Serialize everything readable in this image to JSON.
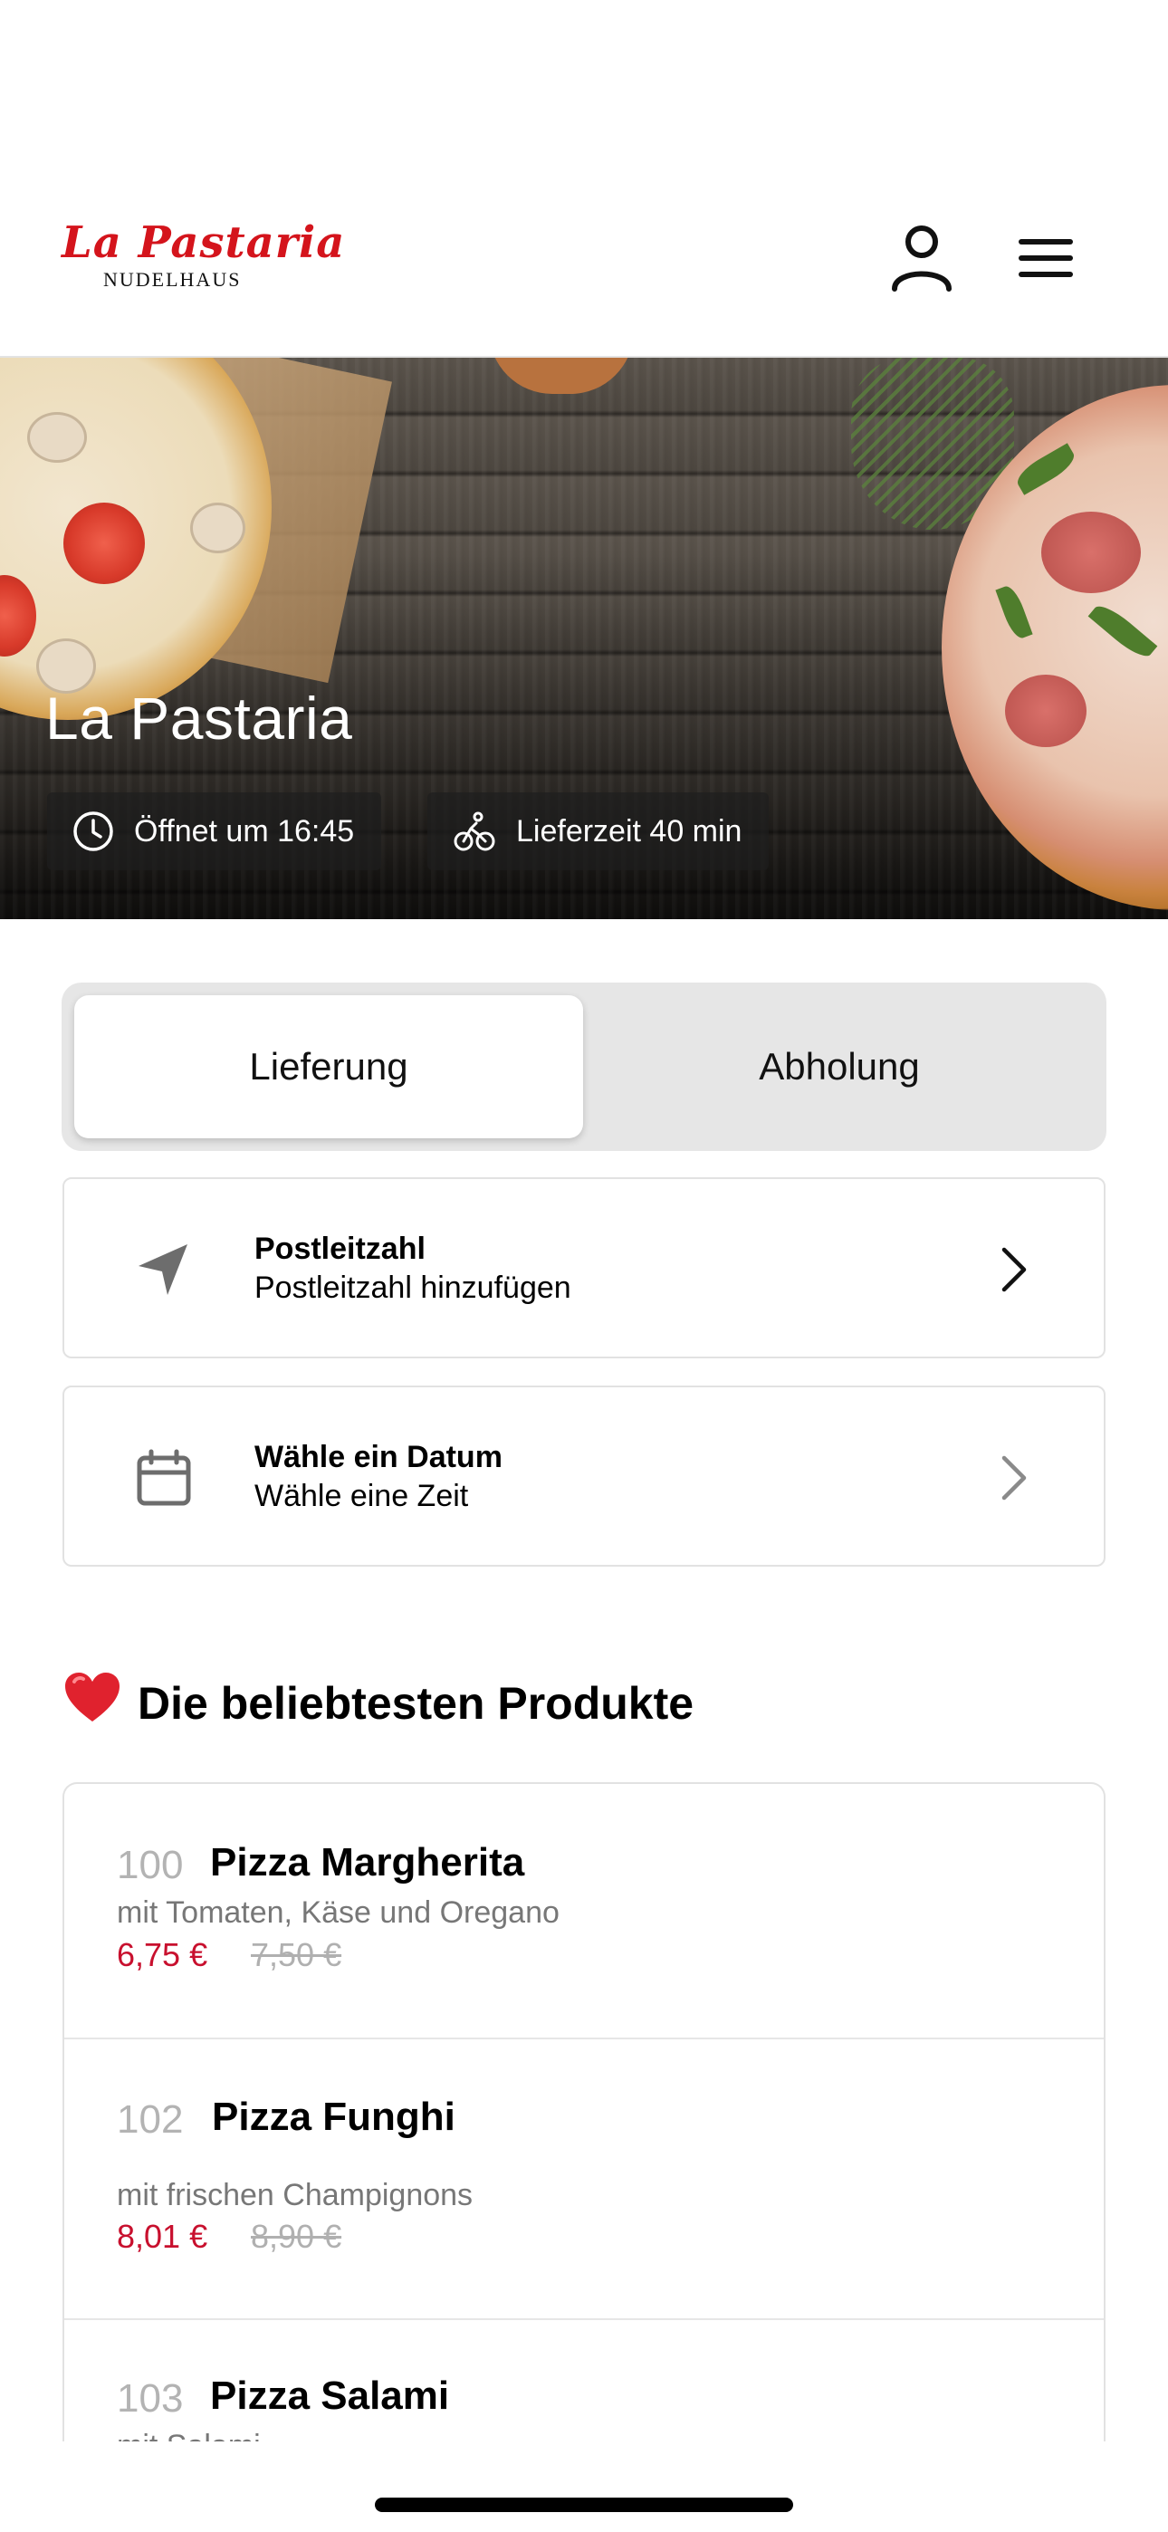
{
  "header": {
    "logo_main": "La Pastaria",
    "logo_sub": "NUDELHAUS",
    "account_icon": "user-icon",
    "menu_icon": "hamburger-icon"
  },
  "hero": {
    "title": "La Pastaria",
    "opening_icon": "clock-icon",
    "opening_text": "Öffnet um 16:45",
    "delivery_icon": "bicycle-icon",
    "delivery_text": "Lieferzeit 40 min"
  },
  "order_mode": {
    "options": [
      "Lieferung",
      "Abholung"
    ],
    "selected": "Lieferung"
  },
  "postcode_card": {
    "icon": "location-arrow-icon",
    "title": "Postleitzahl",
    "subtitle": "Postleitzahl hinzufügen"
  },
  "date_card": {
    "icon": "calendar-icon",
    "title": "Wähle ein Datum",
    "subtitle": "Wähle eine Zeit"
  },
  "popular": {
    "heading": "Die beliebtesten Produkte",
    "heading_emoji": "❤️",
    "products": [
      {
        "number": "100",
        "name": "Pizza Margherita",
        "description": "mit Tomaten, Käse und Oregano",
        "price": "6,75 €",
        "old_price": "7,50 €"
      },
      {
        "number": "102",
        "name": "Pizza Funghi",
        "description": "mit frischen Champignons",
        "price": "8,01 €",
        "old_price": "8,90 €"
      },
      {
        "number": "103",
        "name": "Pizza Salami",
        "description": "mit Salami",
        "price": "",
        "old_price": ""
      }
    ]
  },
  "colors": {
    "brand_red": "#d4141c",
    "price_red": "#c8102e"
  }
}
